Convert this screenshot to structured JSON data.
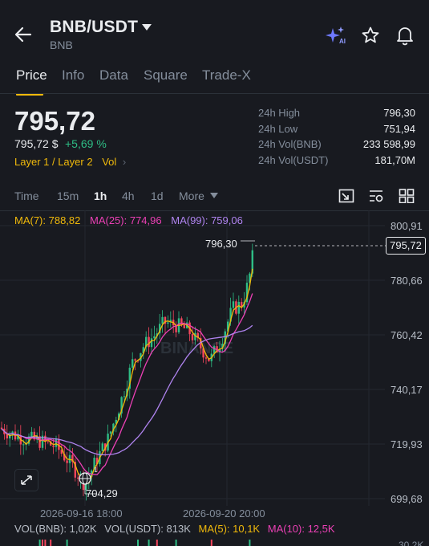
{
  "header": {
    "pair": "BNB/USDT",
    "subtitle": "BNB"
  },
  "tabs": [
    "Price",
    "Info",
    "Data",
    "Square",
    "Trade-X"
  ],
  "price": {
    "last": "795,72",
    "usd": "795,72 $",
    "change": "+5,69 %",
    "tags": "Layer 1 / Layer 2",
    "tags_extra": "Vol"
  },
  "stats": [
    {
      "label": "24h High",
      "value": "796,30"
    },
    {
      "label": "24h Low",
      "value": "751,94"
    },
    {
      "label": "24h Vol(BNB)",
      "value": "233 598,99"
    },
    {
      "label": "24h Vol(USDT)",
      "value": "181,70M"
    }
  ],
  "timeframes": [
    "Time",
    "15m",
    "1h",
    "4h",
    "1d",
    "More"
  ],
  "active_timeframe": "1h",
  "ma_legend": {
    "ma7": "MA(7): 788,82",
    "ma25": "MA(25): 774,96",
    "ma99": "MA(99): 759,06"
  },
  "chart_data": {
    "type": "line",
    "series_type": "candlestick",
    "y_ticks": [
      "800,91",
      "780,66",
      "760,42",
      "740,17",
      "719,93",
      "699,68"
    ],
    "y_range": [
      699.68,
      800.91
    ],
    "x_ticks": [
      "2026-09-16 18:00",
      "2026-09-20 20:00"
    ],
    "high_marker": "796,30",
    "low_marker": "704,29",
    "last_price": "795,72",
    "watermark": "BINANCE",
    "colors": {
      "up": "#2ebd85",
      "down": "#f6465d",
      "ma7": "#f0b90b",
      "ma25": "#eb40b5",
      "ma99": "#b084f0"
    }
  },
  "volume": {
    "vol_bnb": "VOL(BNB): 1,02K",
    "vol_usdt": "VOL(USDT): 813K",
    "ma5": "MA(5): 10,1K",
    "ma10": "MA(10): 12,5K",
    "cut_label": "30,2K"
  }
}
